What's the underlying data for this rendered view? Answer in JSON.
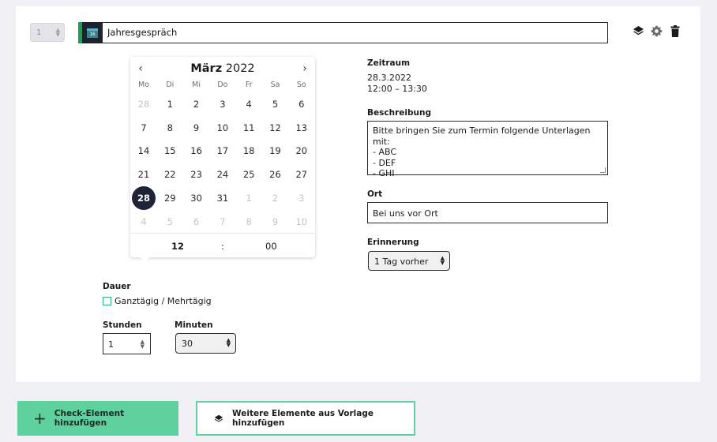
{
  "item": {
    "order_value": "1",
    "title": "Jahresgespräch",
    "calendar_icon_day": "16"
  },
  "header_icons": [
    "layers-icon",
    "gear-icon",
    "trash-icon"
  ],
  "datepicker": {
    "month": "März",
    "year": "2022",
    "weekdays": [
      "Mo",
      "Di",
      "Mi",
      "Do",
      "Fr",
      "Sa",
      "So"
    ],
    "weeks": [
      [
        {
          "d": "28",
          "m": true
        },
        {
          "d": "1"
        },
        {
          "d": "2"
        },
        {
          "d": "3"
        },
        {
          "d": "4"
        },
        {
          "d": "5"
        },
        {
          "d": "6"
        }
      ],
      [
        {
          "d": "7"
        },
        {
          "d": "8"
        },
        {
          "d": "9"
        },
        {
          "d": "10"
        },
        {
          "d": "11"
        },
        {
          "d": "12"
        },
        {
          "d": "13"
        }
      ],
      [
        {
          "d": "14"
        },
        {
          "d": "15"
        },
        {
          "d": "16"
        },
        {
          "d": "17"
        },
        {
          "d": "18"
        },
        {
          "d": "19"
        },
        {
          "d": "20"
        }
      ],
      [
        {
          "d": "21"
        },
        {
          "d": "22"
        },
        {
          "d": "23"
        },
        {
          "d": "24"
        },
        {
          "d": "25"
        },
        {
          "d": "26"
        },
        {
          "d": "27"
        }
      ],
      [
        {
          "d": "28",
          "s": true
        },
        {
          "d": "29"
        },
        {
          "d": "30"
        },
        {
          "d": "31"
        },
        {
          "d": "1",
          "m": true
        },
        {
          "d": "2",
          "m": true
        },
        {
          "d": "3",
          "m": true
        }
      ],
      [
        {
          "d": "4",
          "m": true
        },
        {
          "d": "5",
          "m": true
        },
        {
          "d": "6",
          "m": true
        },
        {
          "d": "7",
          "m": true
        },
        {
          "d": "8",
          "m": true
        },
        {
          "d": "9",
          "m": true
        },
        {
          "d": "10",
          "m": true
        }
      ]
    ],
    "hour": "12",
    "separator": ":",
    "minute": "00"
  },
  "zeitraum": {
    "label": "Zeitraum",
    "date": "28.3.2022",
    "time": "12:00 – 13:30"
  },
  "beschreibung": {
    "label": "Beschreibung",
    "lines": [
      "Bitte bringen Sie zum Termin folgende Unterlagen mit:",
      "- ABC",
      "- DEF",
      "- GHI"
    ]
  },
  "ort": {
    "label": "Ort",
    "value": "Bei uns vor Ort"
  },
  "erinnerung": {
    "label": "Erinnerung",
    "value": "1 Tag vorher"
  },
  "dauer": {
    "label": "Dauer",
    "checkbox_label": "Ganztägig / Mehrtägig",
    "stunden_label": "Stunden",
    "stunden_value": "1",
    "minuten_label": "Minuten",
    "minuten_value": "30"
  },
  "actions": {
    "add_check": "Check-Element hinzufügen",
    "add_template": "Weitere Elemente aus Vorlage hinzufügen"
  },
  "colors": {
    "accent_green": "#5ed19e",
    "selected_day": "#1e2436",
    "background": "#efeff4"
  }
}
